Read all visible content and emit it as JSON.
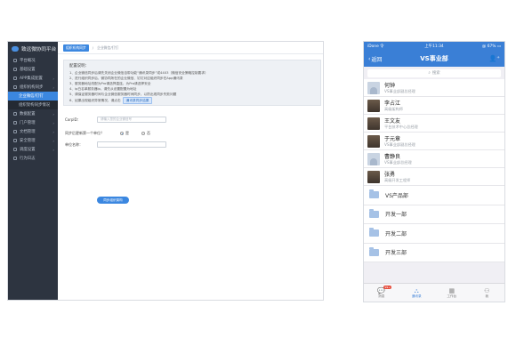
{
  "admin": {
    "logo_text": "致远微协同平台",
    "sidebar": [
      {
        "label": "平台概况",
        "type": "item"
      },
      {
        "label": "基础设置",
        "type": "item"
      },
      {
        "label": "APP集成配置",
        "type": "parent"
      },
      {
        "label": "组织机构同步",
        "type": "parent"
      },
      {
        "label": "企业微信/钉钉",
        "type": "sub-active"
      },
      {
        "label": "组织架构同步情况",
        "type": "sub"
      },
      {
        "label": "数据配置",
        "type": "parent"
      },
      {
        "label": "门户管理",
        "type": "parent"
      },
      {
        "label": "文档管理",
        "type": "parent"
      },
      {
        "label": "安全管理",
        "type": "parent"
      },
      {
        "label": "调度设置",
        "type": "parent"
      },
      {
        "label": "行为日志",
        "type": "item"
      }
    ],
    "breadcrumb": [
      "组织机构同步",
      "企业微信/钉钉"
    ],
    "note": {
      "title": "配置说明：",
      "lines": [
        "1、企业微信同步后请先关闭企业微信自带功能“通讯录同步”或4403（微信安全策略控制要求）",
        "2、进行组织同步后，微协同所在的企业微信、钉钉对应组织同步在App通讯录",
        "3、服务器地址改配为Pro请选择直连，为Pro请选择安全",
        "4、ip白名单服务器ip，请先从设置配置为地址",
        "5、请保证服务器时间与企业微信服务器时间同步，以防出现同步失败问题",
        "6、如果出现组织异常情况，请点击"
      ],
      "inline_button": "通讯录同步结果"
    },
    "form": {
      "corpid_label": "CorpID：",
      "corpid_placeholder": "请输入您的企业微信号",
      "sync_question": "同步后更新第一个单位？",
      "radio_yes": "是",
      "radio_no": "否",
      "unit_label": "单位名称：",
      "unit_value": "",
      "save_button": "同步组织架构"
    }
  },
  "phone": {
    "status": {
      "carrier": "iDone 令",
      "time": "上午11:34",
      "battery": "@ 67% ▭"
    },
    "nav": {
      "back": "返回",
      "title": "VS事业部",
      "add_icon": "add-user-icon"
    },
    "search_placeholder": "搜索",
    "people": [
      {
        "name": "何钟",
        "title": "VS事业部副总经理",
        "avatar": "placeholder"
      },
      {
        "name": "李占江",
        "title": "高级架构师",
        "avatar": "photo"
      },
      {
        "name": "王文友",
        "title": "平台技术中心总经理",
        "avatar": "photo"
      },
      {
        "name": "于元章",
        "title": "VS事业部副总经理",
        "avatar": "photo"
      },
      {
        "name": "曹静良",
        "title": "VS事业部总经理",
        "avatar": "placeholder"
      },
      {
        "name": "张勇",
        "title": "高级开发工程师",
        "avatar": "photo"
      }
    ],
    "departments": [
      "VS产品部",
      "开发一部",
      "开发二部",
      "开发三部"
    ],
    "tabs": [
      {
        "label": "消息",
        "icon": "chat-icon",
        "badge": "99+"
      },
      {
        "label": "通讯录",
        "icon": "org-tree-icon",
        "active": true
      },
      {
        "label": "工作台",
        "icon": "grid-icon"
      },
      {
        "label": "我",
        "icon": "person-icon"
      }
    ],
    "accent_color": "#3a7fd6"
  }
}
